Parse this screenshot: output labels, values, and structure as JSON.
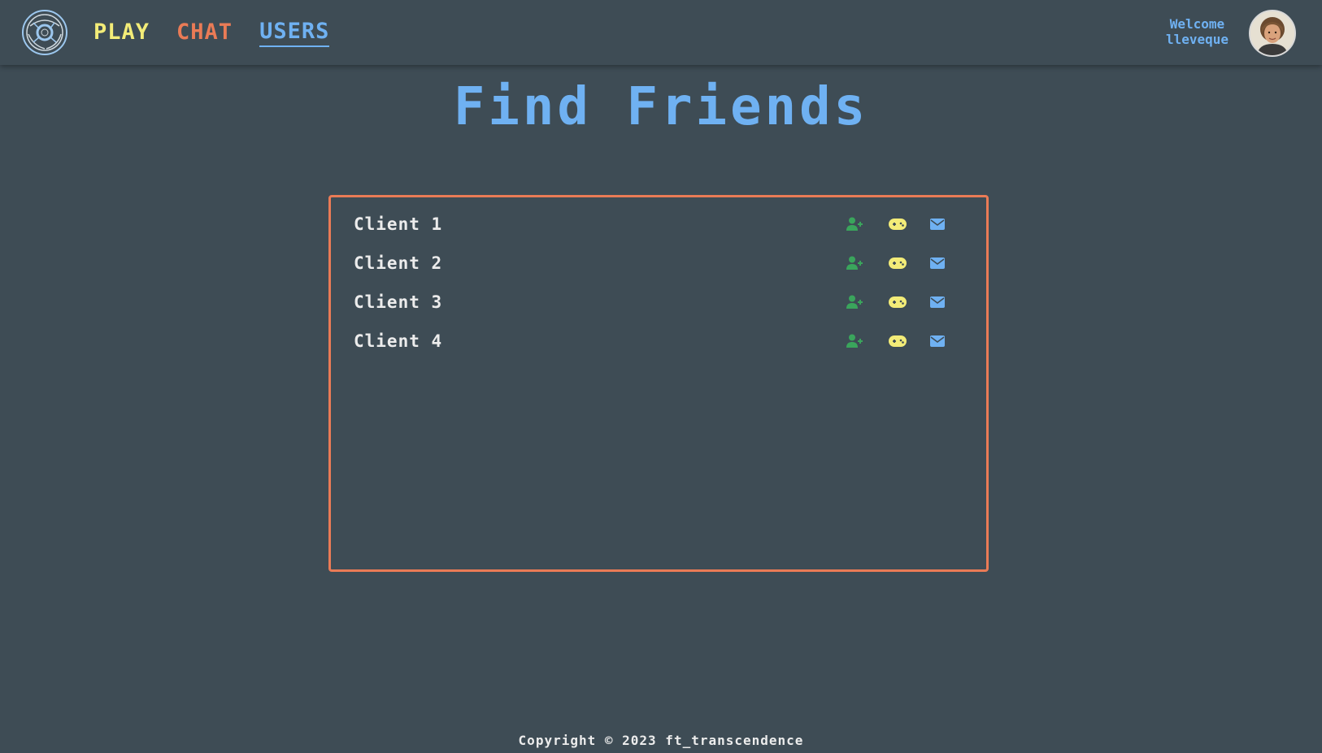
{
  "header": {
    "nav": [
      {
        "label": "PLAY",
        "color": "#f3ec78"
      },
      {
        "label": "CHAT",
        "color": "#ea7b56"
      },
      {
        "label": "USERS",
        "color": "#6fb1f2",
        "active": true
      }
    ],
    "welcome_line1": "Welcome",
    "welcome_line2": "lleveque"
  },
  "main": {
    "title": "Find Friends",
    "users": [
      {
        "name": "Client 1",
        "actions": [
          "add-friend-icon",
          "gamepad-icon",
          "envelope-icon"
        ]
      },
      {
        "name": "Client 2",
        "actions": [
          "add-friend-icon",
          "gamepad-icon",
          "envelope-icon"
        ]
      },
      {
        "name": "Client 3",
        "actions": [
          "add-friend-icon",
          "gamepad-icon",
          "envelope-icon"
        ]
      },
      {
        "name": "Client 4",
        "actions": [
          "add-friend-icon",
          "gamepad-icon",
          "envelope-icon"
        ]
      }
    ]
  },
  "footer": {
    "copyright": "Copyright © 2023 ft_transcendence"
  },
  "colors": {
    "background": "#3e4c55",
    "accent_blue": "#6fb1f2",
    "accent_orange": "#ea7b56",
    "accent_yellow": "#f3ec78",
    "add_green": "#3aa55c"
  }
}
